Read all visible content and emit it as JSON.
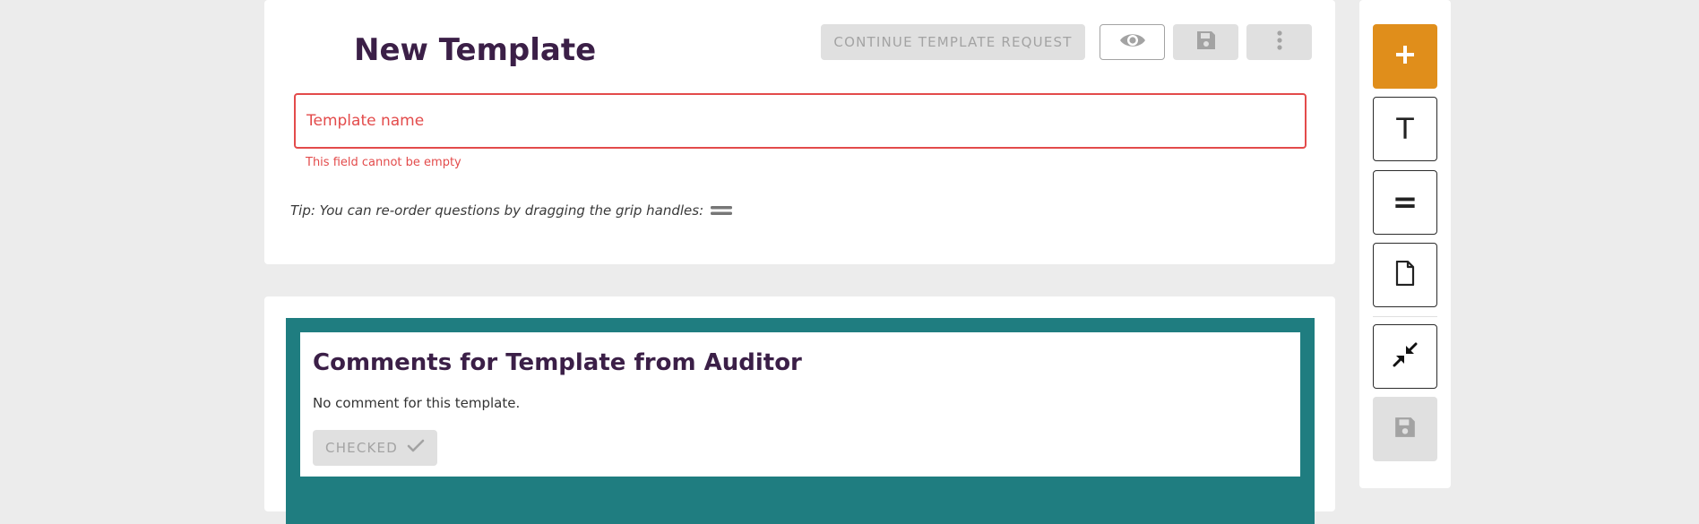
{
  "header": {
    "title": "New Template",
    "continue_label": "CONTINUE TEMPLATE REQUEST",
    "preview_icon": "eye-icon",
    "save_icon": "floppy-disk-icon",
    "more_icon": "vertical-dots-icon"
  },
  "form": {
    "name_placeholder": "Template name",
    "name_value": "",
    "error": "This field cannot be empty",
    "tip": "Tip: You can re-order questions by dragging the grip handles:"
  },
  "comments": {
    "title": "Comments for Template from Auditor",
    "text": "No comment for this template.",
    "checked_label": "CHECKED"
  },
  "side_panel": {
    "add_icon": "plus-icon",
    "text_label": "T",
    "choice_label": "=",
    "file_icon": "file-icon",
    "collapse_icon": "collapse-arrows-icon",
    "save_icon": "floppy-disk-icon"
  },
  "colors": {
    "title": "#3b1f47",
    "error": "#e34b4b",
    "accent": "#e08e1b",
    "comments_frame": "#1f7d80",
    "disabled_bg": "#e0e0e0",
    "disabled_text": "#a3a3a3"
  }
}
